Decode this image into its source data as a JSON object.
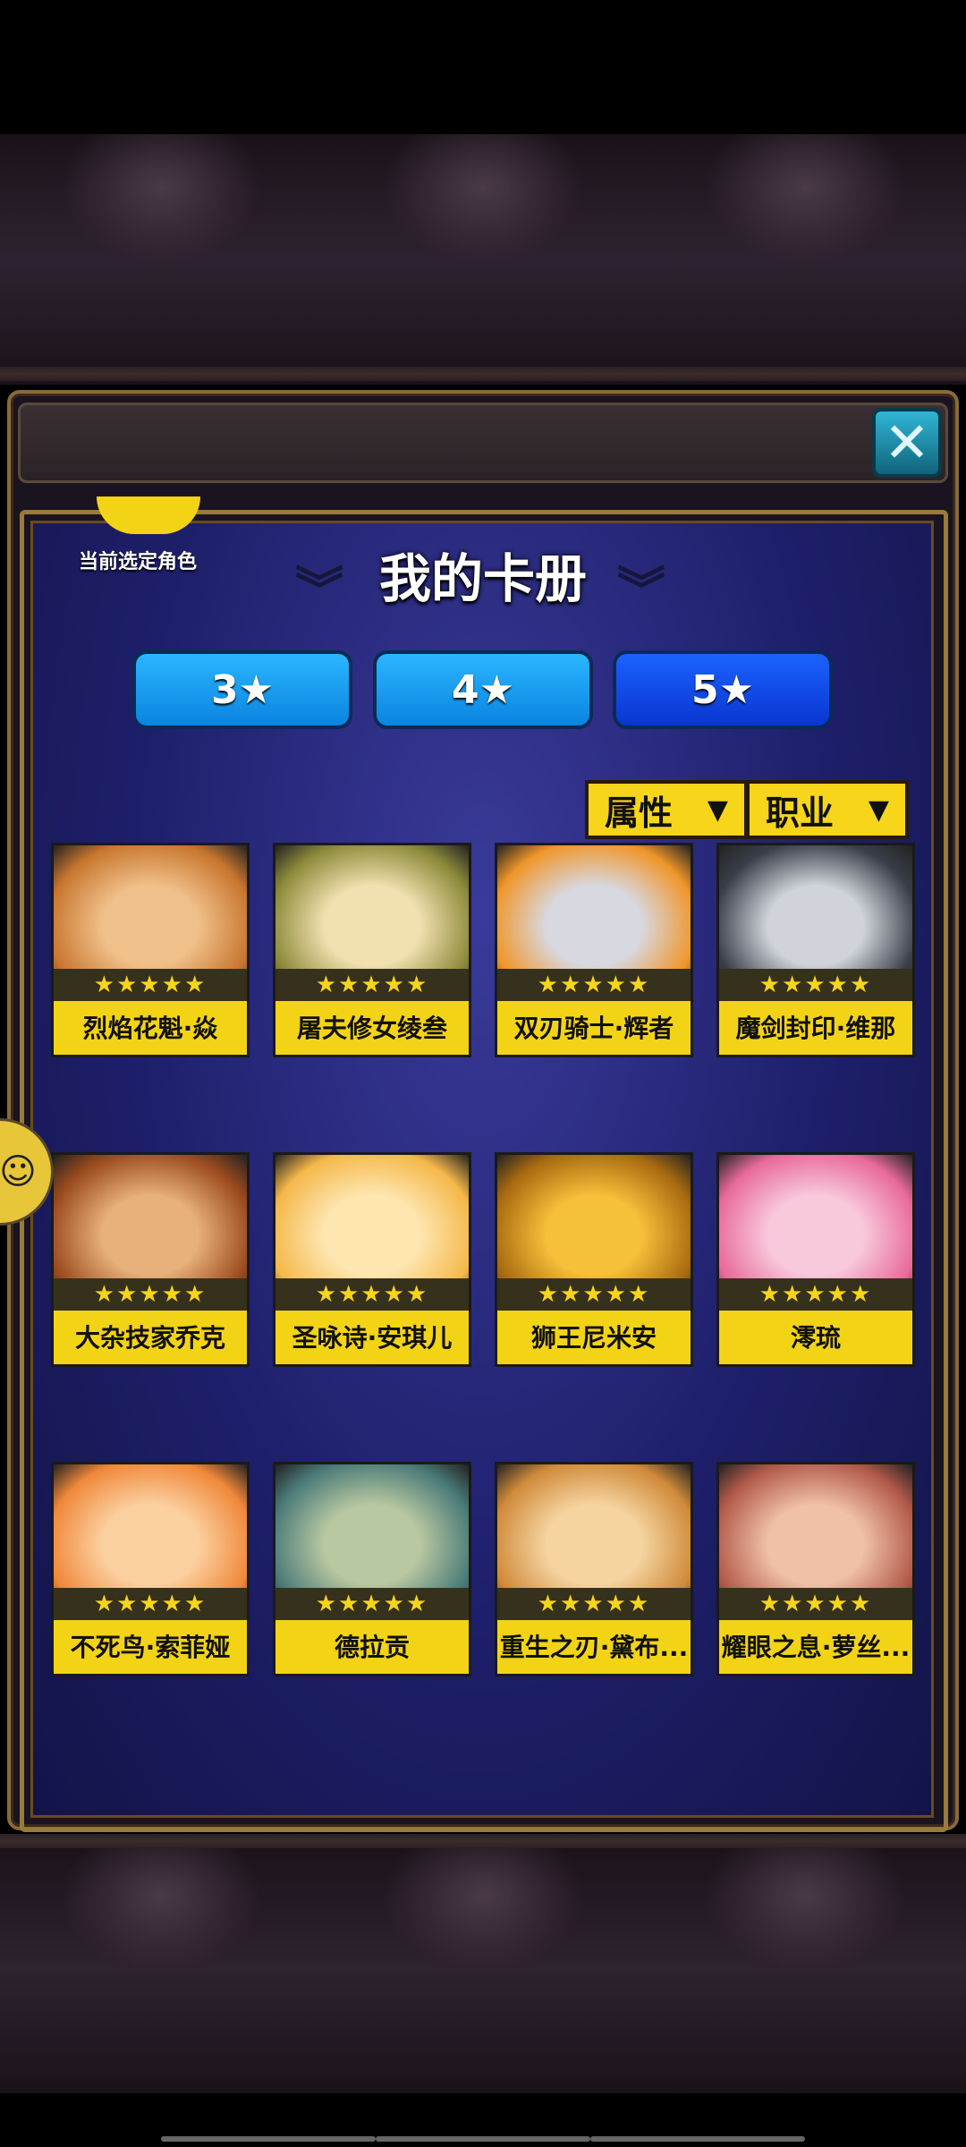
{
  "header": {
    "close_icon": "close-icon",
    "selected_role_label": "当前选定角色",
    "title": "我的卡册"
  },
  "tabs": [
    {
      "label": "3★",
      "active": false
    },
    {
      "label": "4★",
      "active": false
    },
    {
      "label": "5★",
      "active": true
    }
  ],
  "filters": {
    "attribute_label": "属性",
    "job_label": "职业",
    "arrow_glyph": "▼"
  },
  "star_rating": "★★★★★",
  "cards": [
    {
      "name": "烈焰花魁·焱",
      "stars": 5,
      "colors": [
        "#f0c08a",
        "#c8762e"
      ]
    },
    {
      "name": "屠夫修女绫叁",
      "stars": 5,
      "colors": [
        "#f2e0b0",
        "#8c8a3a"
      ]
    },
    {
      "name": "双刃骑士·辉者",
      "stars": 5,
      "colors": [
        "#d8d8e0",
        "#f0962a"
      ]
    },
    {
      "name": "魔剑封印·维那",
      "stars": 5,
      "colors": [
        "#d0d4da",
        "#3a3e48"
      ]
    },
    {
      "name": "大杂技家乔克",
      "stars": 5,
      "colors": [
        "#e8b07a",
        "#9a4a1e"
      ]
    },
    {
      "name": "圣咏诗·安琪儿",
      "stars": 5,
      "colors": [
        "#fde6b0",
        "#f5b84a"
      ]
    },
    {
      "name": "狮王尼米安",
      "stars": 5,
      "colors": [
        "#f5c03a",
        "#a86a10"
      ]
    },
    {
      "name": "澪琉",
      "stars": 5,
      "colors": [
        "#f8c8dc",
        "#e86a9a"
      ]
    },
    {
      "name": "不死鸟·索菲娅",
      "stars": 5,
      "colors": [
        "#fbd0a0",
        "#f0883a"
      ]
    },
    {
      "name": "德拉贡",
      "stars": 5,
      "colors": [
        "#b8c8a0",
        "#4a7a78"
      ]
    },
    {
      "name": "重生之刃·黛布...",
      "stars": 5,
      "colors": [
        "#f5d4a0",
        "#d08a3a"
      ]
    },
    {
      "name": "耀眼之息·萝丝...",
      "stars": 5,
      "colors": [
        "#f0c0a8",
        "#b25a4a"
      ]
    }
  ],
  "side_button_icon": "face-icon"
}
